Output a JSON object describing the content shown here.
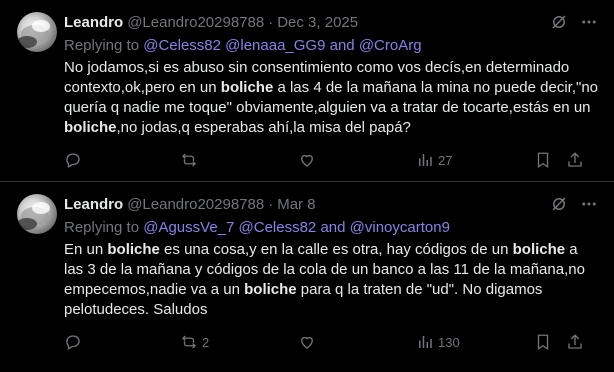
{
  "tweets": [
    {
      "author_name": "Leandro",
      "handle": "@Leandro20298788",
      "separator": "·",
      "date": "Dec 3, 2025",
      "replying_prefix": "Replying to ",
      "replying_to": [
        "@Celess82",
        "@lenaaa_GG9"
      ],
      "replying_and": " and ",
      "replying_last": "@CroArg",
      "body_segments": [
        {
          "t": "No jodamos,si es abuso sin consentimiento como vos decís,en determinado contexto,ok,pero en un ",
          "b": false
        },
        {
          "t": "boliche",
          "b": true
        },
        {
          "t": " a las 4 de la mañana la mina no puede decir,\"no quería q nadie me toque\" obviamente,alguien va a tratar de tocarte,estás en un ",
          "b": false
        },
        {
          "t": "boliche",
          "b": true
        },
        {
          "t": ",no jodas,q esperabas ahí,la misa del papá?",
          "b": false
        }
      ],
      "reply_count": "",
      "retweet_count": "",
      "like_count": "",
      "views_count": "27"
    },
    {
      "author_name": "Leandro",
      "handle": "@Leandro20298788",
      "separator": "·",
      "date": "Mar 8",
      "replying_prefix": "Replying to ",
      "replying_to": [
        "@AgussVe_7",
        "@Celess82"
      ],
      "replying_and": " and ",
      "replying_last": "@vinoycarton9",
      "body_segments": [
        {
          "t": "En un ",
          "b": false
        },
        {
          "t": "boliche",
          "b": true
        },
        {
          "t": " es una cosa,y en la calle es otra, hay códigos de un ",
          "b": false
        },
        {
          "t": "boliche",
          "b": true
        },
        {
          "t": " a las 3 de la mañana y códigos de la cola de un banco a las 11 de la mañana,no empecemos,nadie va a un ",
          "b": false
        },
        {
          "t": "boliche",
          "b": true
        },
        {
          "t": " para q la traten de \"ud\". No digamos pelotudeces. Saludos",
          "b": false
        }
      ],
      "reply_count": "",
      "retweet_count": "2",
      "like_count": "",
      "views_count": "130"
    }
  ],
  "colors": {
    "background": "#000000",
    "text": "#e7e9ea",
    "muted": "#71767b",
    "mention": "#8a80e6",
    "divider": "#2f3336"
  },
  "icons": [
    "grok-icon",
    "more-icon",
    "reply-icon",
    "retweet-icon",
    "like-icon",
    "views-icon",
    "bookmark-icon",
    "share-icon"
  ]
}
